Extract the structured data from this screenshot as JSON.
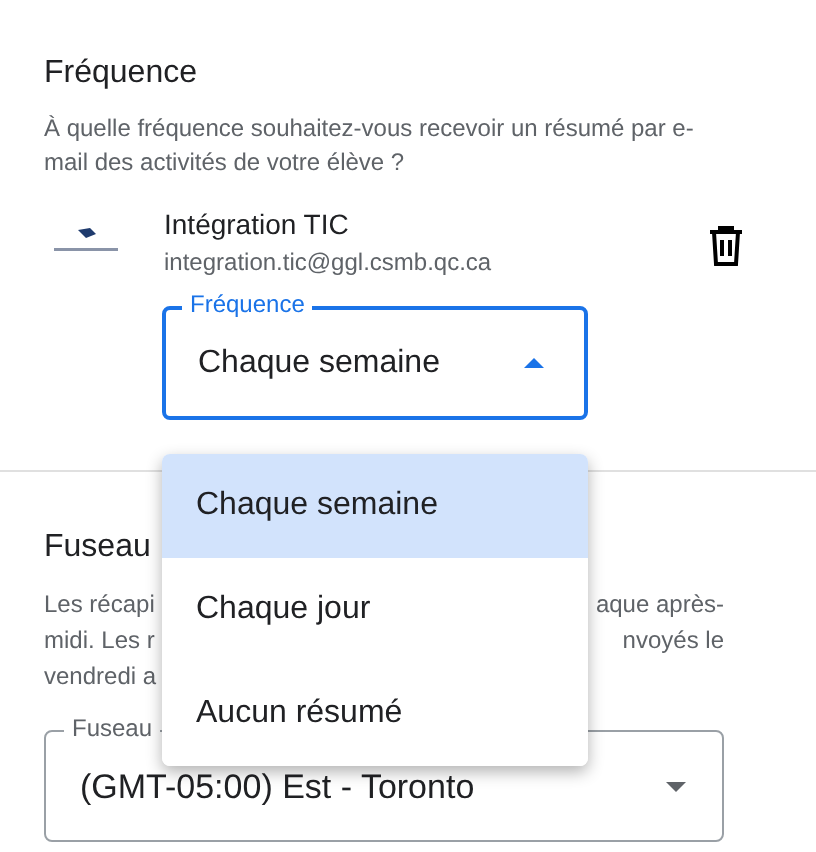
{
  "frequency_section": {
    "title": "Fréquence",
    "description": "À quelle fréquence souhaitez-vous recevoir un résumé par e-mail des activités de votre élève ?",
    "guardian": {
      "name": "Intégration TIC",
      "email": "integration.tic@ggl.csmb.qc.ca"
    },
    "select": {
      "label": "Fréquence",
      "value": "Chaque semaine",
      "expanded": true
    }
  },
  "timezone_section": {
    "title": "Fuseau",
    "description_lines": [
      {
        "left": "Les récapi",
        "right": "aque après-"
      },
      {
        "left": "midi. Les r",
        "right": "nvoyés le"
      },
      {
        "left": "vendredi a"
      }
    ],
    "select": {
      "label": "Fuseau",
      "value": "(GMT-05:00) Est - Toronto"
    }
  },
  "menu": {
    "options": [
      {
        "label": "Chaque semaine",
        "selected": true
      },
      {
        "label": "Chaque jour",
        "selected": false
      },
      {
        "label": "Aucun résumé",
        "selected": false
      }
    ]
  }
}
